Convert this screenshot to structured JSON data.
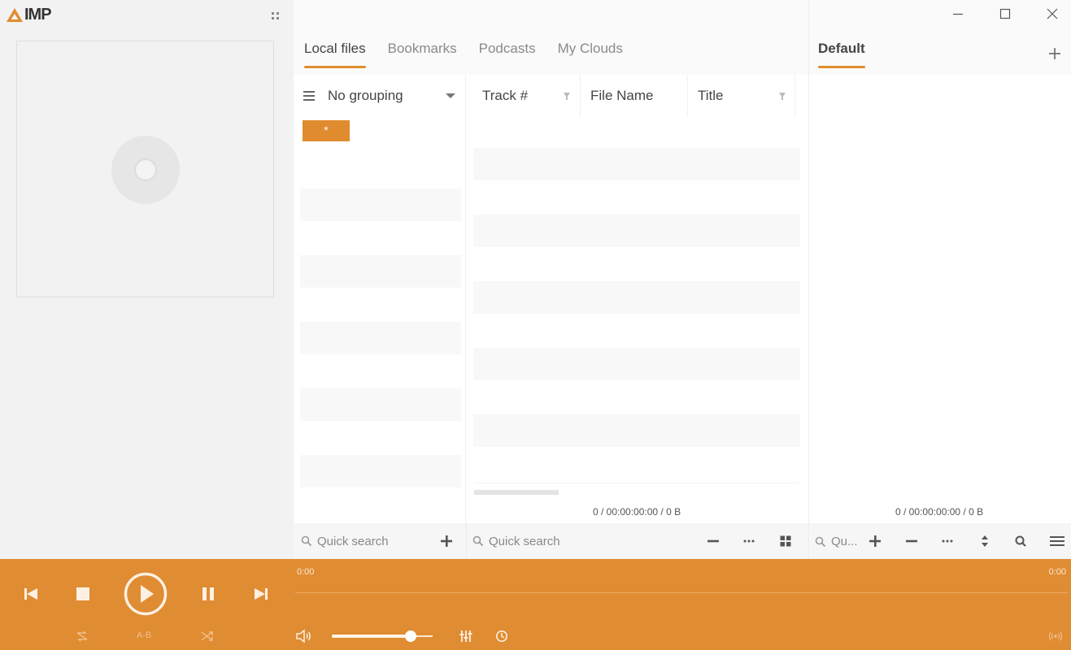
{
  "app": {
    "logo_text": "IMP",
    "accent_color": "#df8c33"
  },
  "window_controls": {
    "minimize_icon": "minimize-icon",
    "maximize_icon": "maximize-icon",
    "close_icon": "close-icon"
  },
  "library": {
    "tabs": [
      {
        "label": "Local files",
        "active": true
      },
      {
        "label": "Bookmarks",
        "active": false
      },
      {
        "label": "Podcasts",
        "active": false
      },
      {
        "label": "My Clouds",
        "active": false
      }
    ],
    "grouping": {
      "label": "No grouping",
      "all_button": "*"
    },
    "columns": [
      {
        "label": "Track #",
        "filter": true
      },
      {
        "label": "File Name",
        "filter": false
      },
      {
        "label": "Title",
        "filter": true
      }
    ],
    "status": "0 / 00:00:00:00 / 0 B",
    "group_search_placeholder": "Quick search",
    "track_search_placeholder": "Quick search"
  },
  "playlist": {
    "tabs": [
      {
        "label": "Default",
        "active": true
      }
    ],
    "status": "0 / 00:00:00:00 / 0 B",
    "search_placeholder": "Qu..."
  },
  "player": {
    "time_elapsed": "0:00",
    "time_total": "0:00",
    "ab_label": "A-B",
    "volume_percent": 78,
    "seek_percent": 0
  }
}
